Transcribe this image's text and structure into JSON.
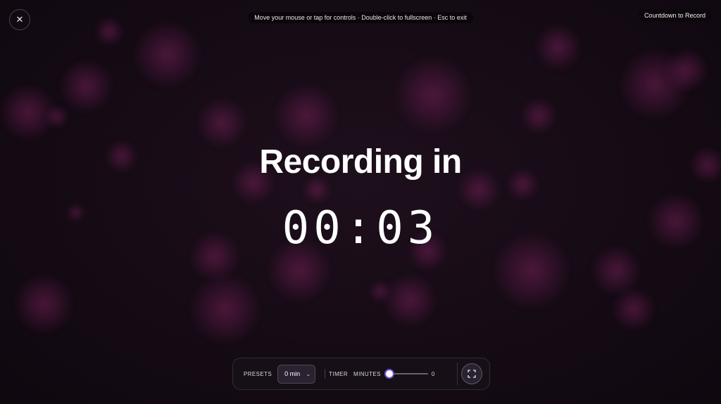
{
  "overlay": {
    "close_icon": "close-icon",
    "hint": "Move your mouse or tap for controls · Double-click to fullscreen · Esc to exit",
    "mode_label": "Countdown to Record"
  },
  "countdown": {
    "heading": "Recording in",
    "time": "00:03"
  },
  "controls": {
    "presets_label": "PRESETS",
    "preset_selected": "0 min",
    "timer_label": "TIMER",
    "minutes_label": "MINUTES",
    "minutes_value": "0",
    "minutes_slider_fraction": 0,
    "fullscreen_icon": "fullscreen-icon"
  },
  "colors": {
    "background": "#120a12",
    "bokeh": "#8a2a6a",
    "slider_accent": "#6a4fd8"
  }
}
